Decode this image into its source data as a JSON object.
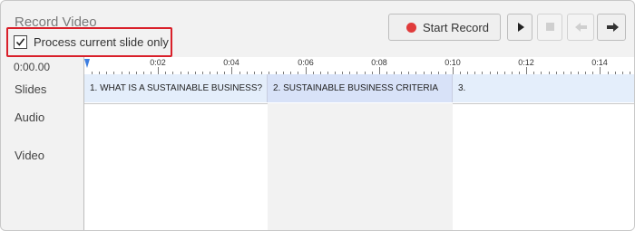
{
  "title": "Record Video",
  "process_checkbox": {
    "label": "Process current slide only",
    "checked": true
  },
  "toolbar": {
    "start_label": "Start Record",
    "play_icon": "play-icon",
    "stop_icon": "stop-icon",
    "prev_icon": "arrow-left-icon",
    "next_icon": "arrow-right-icon"
  },
  "timecode": "0:00.00",
  "rows": {
    "slides": "Slides",
    "audio": "Audio",
    "video": "Video"
  },
  "ruler": {
    "ticks": [
      "0:02",
      "0:04",
      "0:06",
      "0:08",
      "0:10",
      "0:12",
      "0:14"
    ]
  },
  "slides": [
    "1. WHAT IS A SUSTAINABLE BUSINESS?",
    "2. SUSTAINABLE BUSINESS CRITERIA",
    "3."
  ],
  "colors": {
    "record": "#e03b3b",
    "highlight_box": "#d9202a",
    "playhead": "#3d7ee0"
  }
}
